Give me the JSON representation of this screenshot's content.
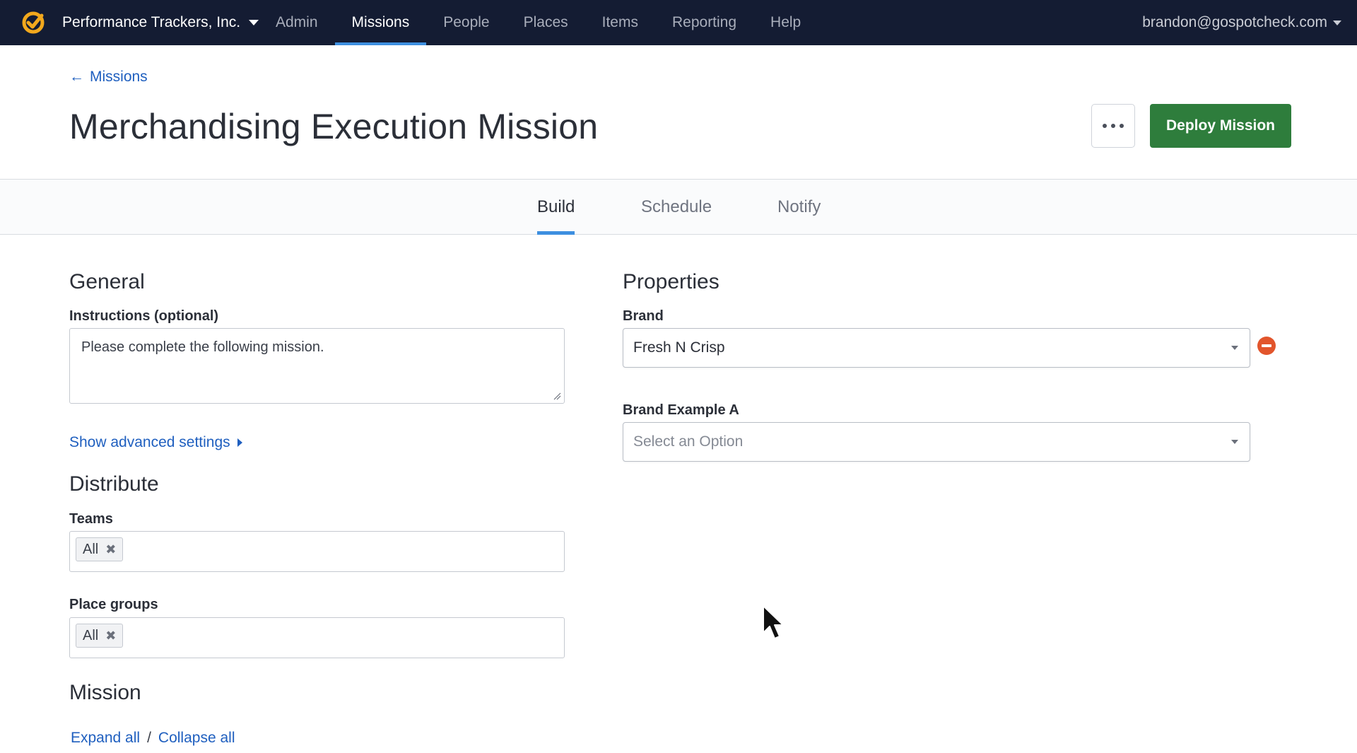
{
  "nav": {
    "org_name": "Performance Trackers, Inc.",
    "links": [
      {
        "label": "Admin",
        "active": false
      },
      {
        "label": "Missions",
        "active": true
      },
      {
        "label": "People",
        "active": false
      },
      {
        "label": "Places",
        "active": false
      },
      {
        "label": "Items",
        "active": false
      },
      {
        "label": "Reporting",
        "active": false
      },
      {
        "label": "Help",
        "active": false
      }
    ],
    "user_email": "brandon@gospotcheck.com"
  },
  "header": {
    "back_label": "Missions",
    "back_arrow": "←",
    "title": "Merchandising Execution Mission",
    "deploy_label": "Deploy Mission"
  },
  "tabs": [
    {
      "label": "Build",
      "active": true
    },
    {
      "label": "Schedule",
      "active": false
    },
    {
      "label": "Notify",
      "active": false
    }
  ],
  "general": {
    "heading": "General",
    "instructions_label": "Instructions (optional)",
    "instructions_value": "Please complete the following mission.",
    "advanced_label": "Show advanced settings"
  },
  "distribute": {
    "heading": "Distribute",
    "teams_label": "Teams",
    "teams_tag": "All",
    "place_groups_label": "Place groups",
    "place_groups_tag": "All",
    "remove_glyph": "✖"
  },
  "mission": {
    "heading": "Mission",
    "expand_label": "Expand all",
    "separator": "/",
    "collapse_label": "Collapse all"
  },
  "properties": {
    "heading": "Properties",
    "brand_label": "Brand",
    "brand_value": "Fresh N Crisp",
    "brand_example_label": "Brand Example A",
    "brand_example_placeholder": "Select an Option"
  },
  "colors": {
    "nav_bg": "#141c33",
    "accent": "#3d8fe0",
    "link": "#1f5fbf",
    "deploy": "#2e7d3c",
    "remove": "#e2552c",
    "logo": "#f2a81d"
  }
}
